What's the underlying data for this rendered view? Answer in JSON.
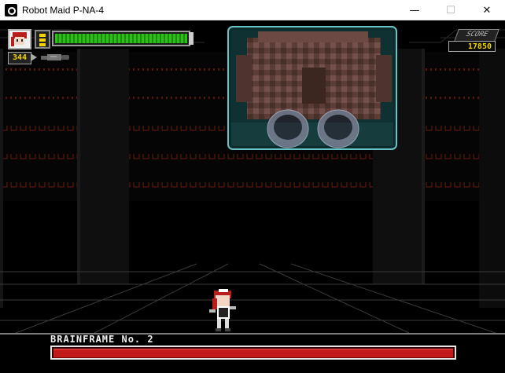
{
  "window": {
    "title": "Robot Maid P-NA-4",
    "icon": "app-icon",
    "controls": {
      "minimize": "—",
      "maximize": "☐",
      "close": "✕"
    }
  },
  "hud": {
    "portrait": "maid-portrait",
    "energy_cells": 3,
    "health_level": 1.0,
    "counter": "344",
    "weapon": "weapon-icon",
    "score_label": "SCORE",
    "score_value": "17850"
  },
  "boss": {
    "name": "BRAINFRAME No. 2",
    "health_level": 1.0
  },
  "colors": {
    "hp_green": "#2fbf1a",
    "boss_red": "#c21a1a",
    "score_yellow": "#f2d200",
    "pillar_gray": "#111111",
    "grid_lines": "#3a3a3a",
    "red_pattern": "#6a1a10",
    "boss_glass": "#67c3c6"
  }
}
